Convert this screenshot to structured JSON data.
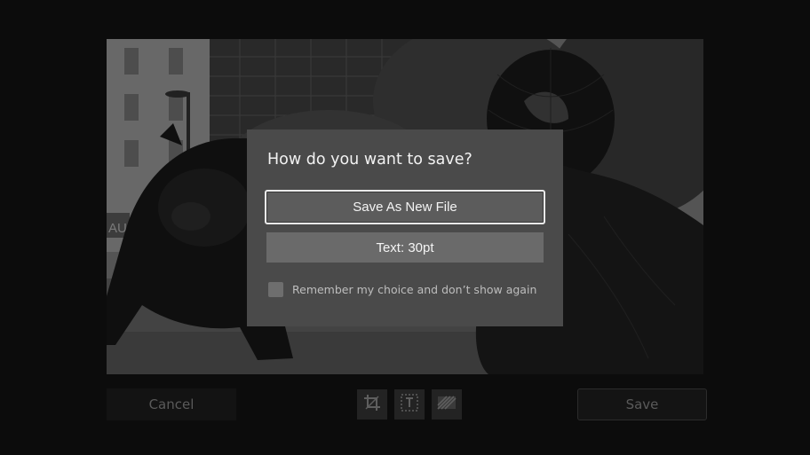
{
  "dialog": {
    "title": "How do you want to save?",
    "options": [
      {
        "label": "Save As New File"
      },
      {
        "label": "Text: 30pt"
      }
    ],
    "remember_label": "Remember my choice and don’t show again",
    "remember_checked": false
  },
  "toolbar": {
    "cancel_label": "Cancel",
    "save_label": "Save",
    "tools": [
      "crop-icon",
      "text-frame-icon",
      "filter-icon"
    ]
  },
  "photo": {
    "storefront_sign": "AUR"
  },
  "colors": {
    "background": "#0c0c0c",
    "dialog": "#4a4a4a",
    "option": "#6a6a6a",
    "focus_border": "#eaeaea"
  }
}
